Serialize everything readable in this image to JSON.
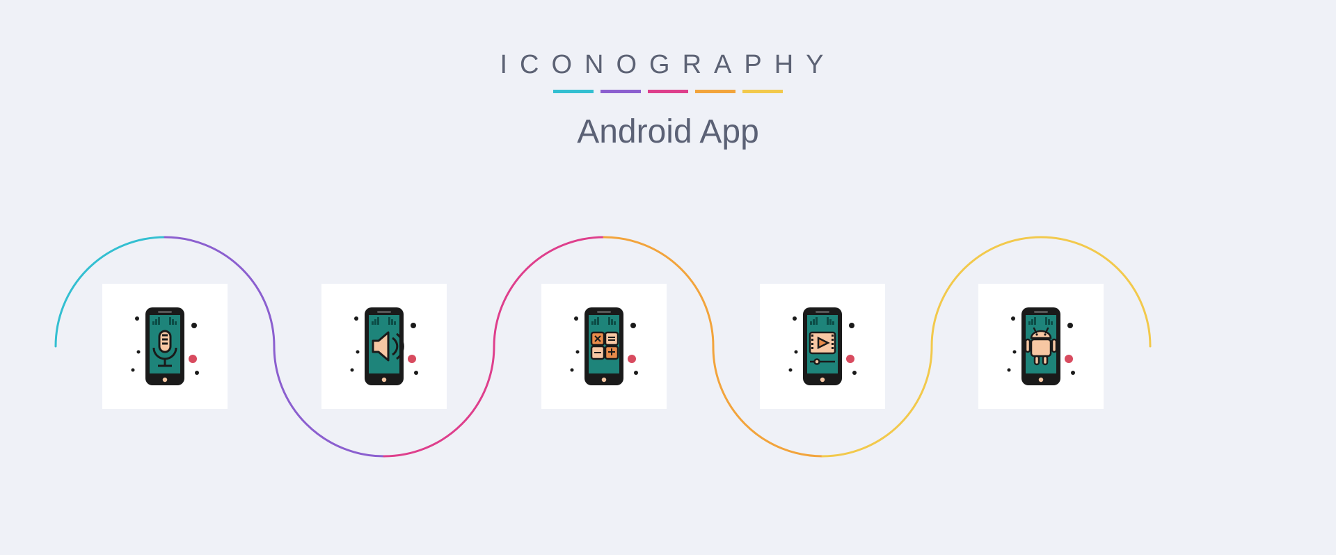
{
  "header": {
    "brand": "ICONOGRAPHY",
    "subtitle": "Android App",
    "stripe_colors": [
      "#33bfd1",
      "#8b5fcf",
      "#de3f8c",
      "#f2a43c",
      "#f2c94c"
    ]
  },
  "wave": {
    "segments": [
      {
        "color": "#33bfd1"
      },
      {
        "color": "#8b5fcf"
      },
      {
        "color": "#de3f8c"
      },
      {
        "color": "#f2a43c"
      },
      {
        "color": "#f2c94c"
      }
    ]
  },
  "icons": [
    {
      "name": "microphone-phone-icon"
    },
    {
      "name": "speaker-phone-icon"
    },
    {
      "name": "calculator-phone-icon"
    },
    {
      "name": "video-phone-icon"
    },
    {
      "name": "android-phone-icon"
    }
  ],
  "palette": {
    "phone_body": "#1a1a1a",
    "screen": "#1e847a",
    "screen_alt": "#196b63",
    "accent_peach": "#f7c7a3",
    "accent_orange": "#e88b4a",
    "dot": "#1a1a1a"
  }
}
